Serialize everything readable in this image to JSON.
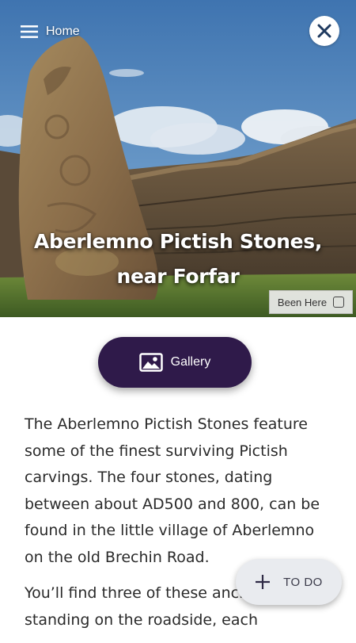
{
  "header": {
    "menu_label": "Home",
    "menu_icon": "hamburger-menu-icon",
    "close_icon": "close-icon"
  },
  "hero": {
    "title_line1": "Aberlemno Pictish Stones,",
    "title_line2": "near Forfar",
    "image_description_icon": "hero-photo"
  },
  "been_here": {
    "label": "Been Here",
    "checked": false
  },
  "gallery_button": {
    "label": "Gallery",
    "icon": "image-icon"
  },
  "article": {
    "paragraphs": [
      "The Aberlemno Pictish Stones feature some of the finest surviving Pictish carvings. The four stones, dating between about AD500 and 800, can be found in the little village of Aberlemno on the old Brechin Road.",
      "You’ll find three of these ancient stones standing on the roadside, each"
    ]
  },
  "todo_button": {
    "label": "TO DO",
    "icon": "plus-icon"
  },
  "colors": {
    "gallery_bg": "#2f1a4a",
    "todo_bg": "#e9ebef",
    "text": "#2a2a2a"
  }
}
